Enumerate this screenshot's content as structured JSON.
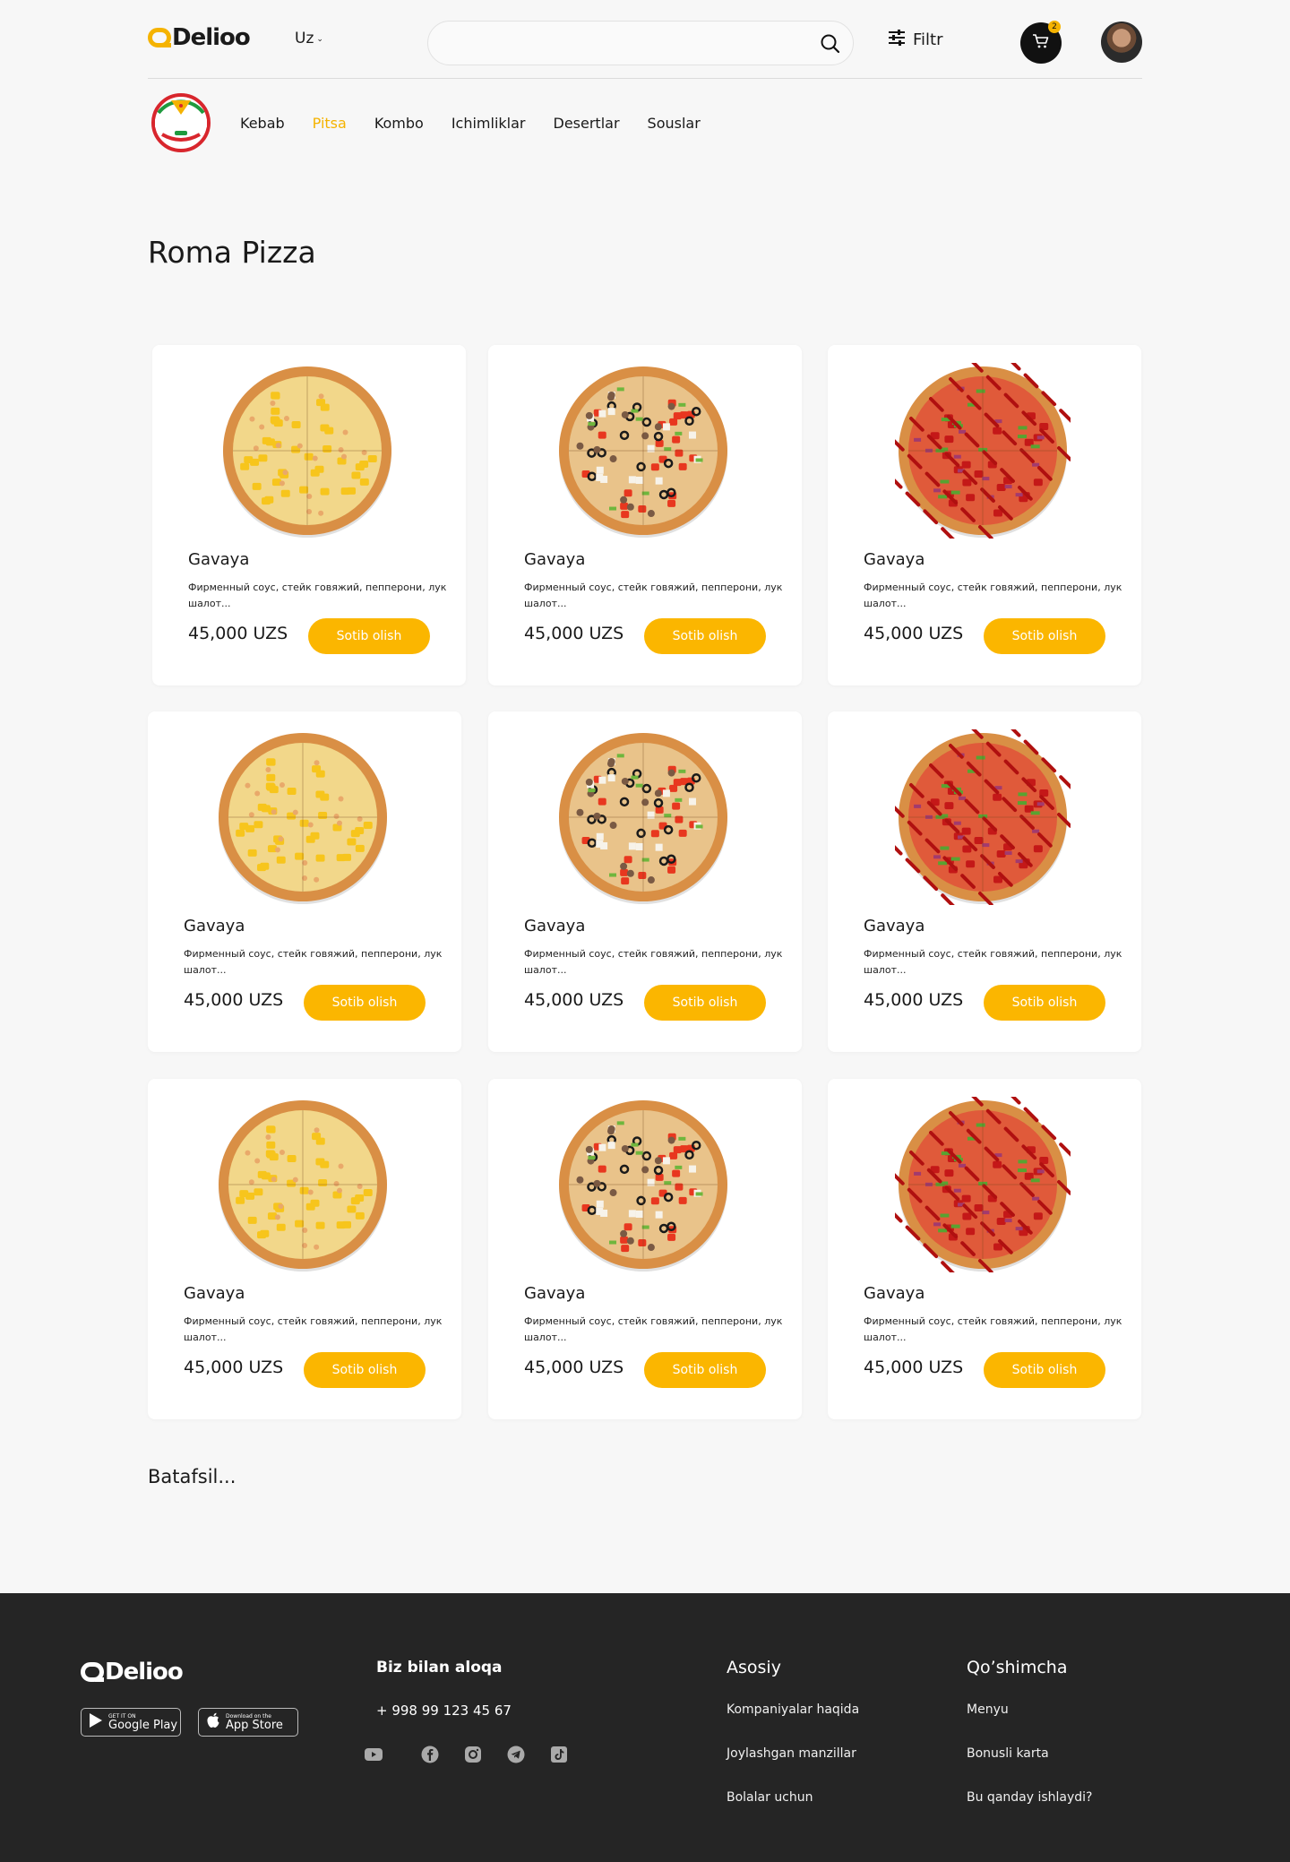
{
  "header": {
    "logo_text": "Delioo",
    "language": "Uz",
    "search_placeholder": "",
    "filter_label": "Filtr",
    "cart_count": "2"
  },
  "categories": [
    {
      "label": "Kebab",
      "active": false
    },
    {
      "label": "Pitsa",
      "active": true
    },
    {
      "label": "Kombo",
      "active": false
    },
    {
      "label": "Ichimliklar",
      "active": false
    },
    {
      "label": "Desertlar",
      "active": false
    },
    {
      "label": "Souslar",
      "active": false
    }
  ],
  "brand_badge_text": "Roma Pizza",
  "page_title": "Roma Pizza",
  "products": [
    {
      "name": "Gavaya",
      "description": "Фирменный соус, стейк говяжий, пепперони, лук шалот...",
      "price": "45,000 UZS",
      "button": "Sotib olish",
      "pizza": "pineapple"
    },
    {
      "name": "Gavaya",
      "description": "Фирменный соус, стейк говяжий, пепперони, лук шалот...",
      "price": "45,000 UZS",
      "button": "Sotib olish",
      "pizza": "veggie"
    },
    {
      "name": "Gavaya",
      "description": "Фирменный соус, стейк говяжий, пепперони, лук шалот...",
      "price": "45,000 UZS",
      "button": "Sotib olish",
      "pizza": "bbq"
    },
    {
      "name": "Gavaya",
      "description": "Фирменный соус, стейк говяжий, пепперони, лук шалот...",
      "price": "45,000 UZS",
      "button": "Sotib olish",
      "pizza": "pineapple"
    },
    {
      "name": "Gavaya",
      "description": "Фирменный соус, стейк говяжий, пепперони, лук шалот...",
      "price": "45,000 UZS",
      "button": "Sotib olish",
      "pizza": "veggie"
    },
    {
      "name": "Gavaya",
      "description": "Фирменный соус, стейк говяжий, пепперони, лук шалот...",
      "price": "45,000 UZS",
      "button": "Sotib olish",
      "pizza": "bbq"
    },
    {
      "name": "Gavaya",
      "description": "Фирменный соус, стейк говяжий, пепперони, лук шалот...",
      "price": "45,000 UZS",
      "button": "Sotib olish",
      "pizza": "pineapple"
    },
    {
      "name": "Gavaya",
      "description": "Фирменный соус, стейк говяжий, пепперони, лук шалот...",
      "price": "45,000 UZS",
      "button": "Sotib olish",
      "pizza": "veggie"
    },
    {
      "name": "Gavaya",
      "description": "Фирменный соус, стейк говяжий, пепперони, лук шалот...",
      "price": "45,000 UZS",
      "button": "Sotib olish",
      "pizza": "bbq"
    }
  ],
  "more_link": "Batafsil...",
  "footer": {
    "logo_text": "Delioo",
    "google_play": {
      "small": "GET IT ON",
      "big": "Google Play"
    },
    "app_store": {
      "small": "Download on the",
      "big": "App Store"
    },
    "contact_title": "Biz bilan aloqa",
    "phone": "+ 998 99 123 45 67",
    "socials": [
      "youtube-icon",
      "facebook-icon",
      "instagram-icon",
      "telegram-icon",
      "tiktok-icon"
    ],
    "col1_title": "Asosiy",
    "col1_links": [
      "Kompaniyalar haqida",
      "Joylashgan manzillar",
      "Bolalar uchun"
    ],
    "col2_title": "Qo’shimcha",
    "col2_links": [
      "Menyu",
      "Bonusli karta",
      "Bu qanday ishlaydi?"
    ]
  },
  "colors": {
    "accent": "#f5b300",
    "button": "#fbb600",
    "footer_bg": "#252525",
    "page_bg": "#f7f7f7"
  }
}
